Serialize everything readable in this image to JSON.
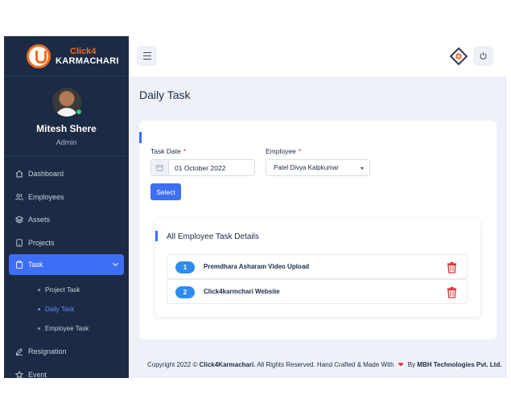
{
  "logo": {
    "top": "Click4",
    "bottom": "KARMACHARI"
  },
  "profile": {
    "name": "Mitesh Shere",
    "role": "Admin"
  },
  "nav": [
    {
      "label": "Dashboard",
      "icon": "home-icon"
    },
    {
      "label": "Employees",
      "icon": "users-icon"
    },
    {
      "label": "Assets",
      "icon": "layers-icon"
    },
    {
      "label": "Projects",
      "icon": "tablet-icon"
    },
    {
      "label": "Task",
      "icon": "clipboard-icon"
    }
  ],
  "subnav": [
    {
      "label": "Project Task"
    },
    {
      "label": "Daily Task"
    },
    {
      "label": "Employee Task"
    }
  ],
  "nav_after": [
    {
      "label": "Resignation",
      "icon": "pen-icon"
    },
    {
      "label": "Event",
      "icon": "star-icon"
    }
  ],
  "page": {
    "title": "Daily Task"
  },
  "form": {
    "date_label": "Task Date",
    "date_value": "01 October 2022",
    "employee_label": "Employee",
    "employee_value": "Patel Divya Kalpkumar",
    "required_mark": "*",
    "select_button": "Select"
  },
  "details": {
    "title": "All Employee Task Details",
    "tasks": [
      {
        "num": "1",
        "name": "Premdhara Asharam Video Upload"
      },
      {
        "num": "2",
        "name": "Click4karmchari Website"
      }
    ]
  },
  "footer": {
    "copyright": "Copyright 2022 ©",
    "brand": "Click4Karmachari.",
    "rights": "All Rights Reserved.  Hand Crafted & Made With",
    "by": "By",
    "company": "MBH Technologies Pvt. Ltd."
  },
  "colors": {
    "sidebar": "#1c2b45",
    "accent": "#3d6ef5",
    "logo_orange": "#f26b21",
    "delete": "#e03131"
  }
}
